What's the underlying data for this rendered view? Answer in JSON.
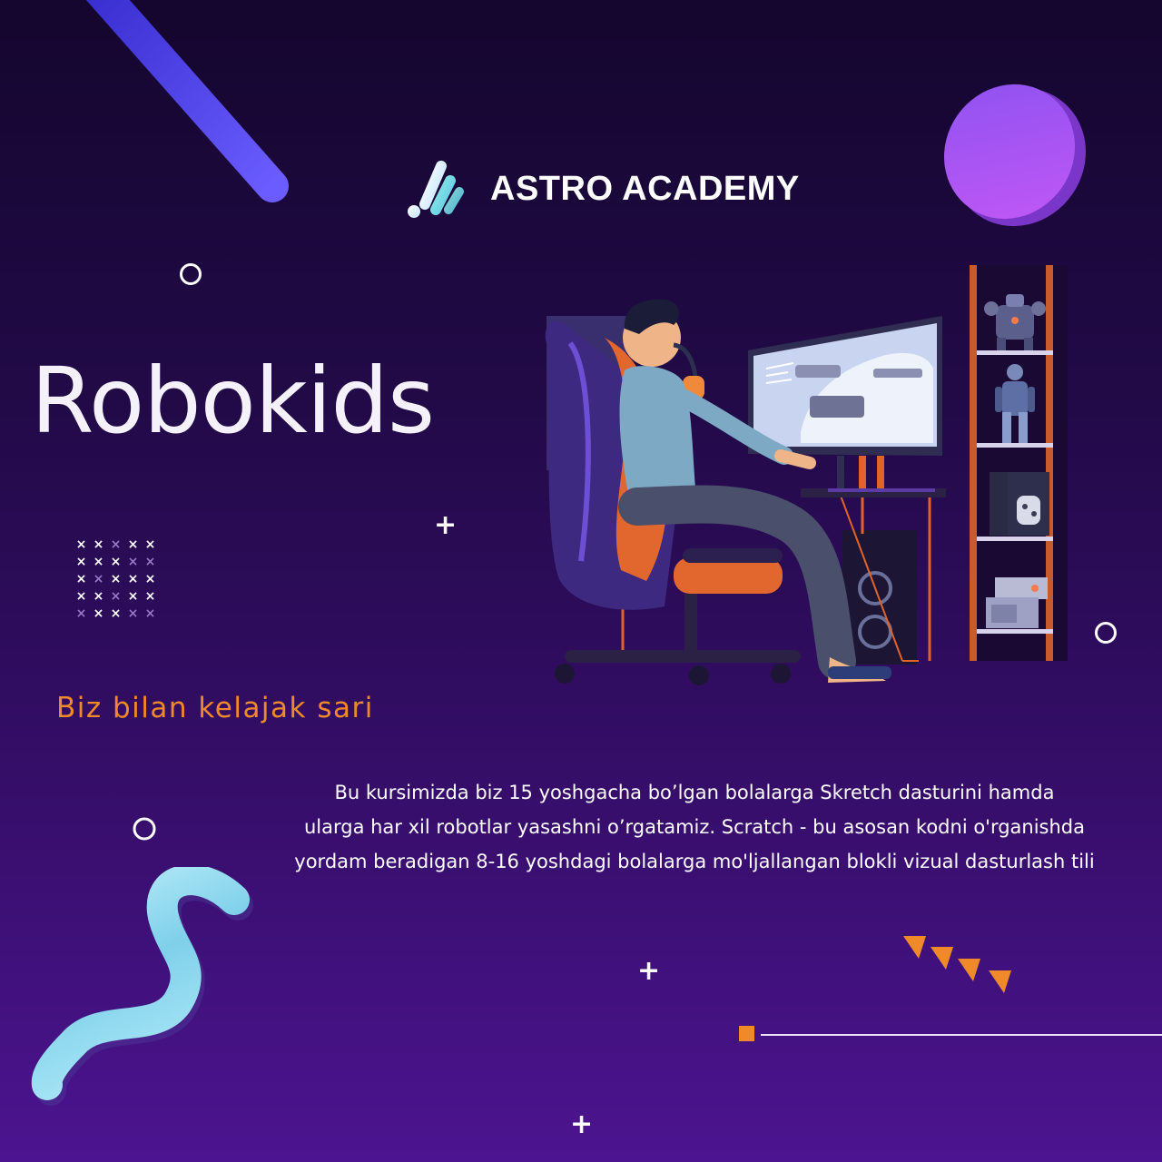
{
  "brand": {
    "name": "ASTRO ACADEMY",
    "logo_icon": "astro-academy-logo-icon",
    "logo_colors": [
      "#eaf6ff",
      "#7fe3e6",
      "#9be7d9"
    ]
  },
  "headline": "Robokids",
  "tagline": "Biz bilan kelajak sari",
  "description": {
    "lines": [
      "Bu kursimizda biz 15 yoshgacha bo’lgan bolalarga Skretch dasturini hamda",
      "ularga har xil robotlar yasashni o’rgatamiz. Scratch - bu asosan kodni o'rganishda",
      "yordam beradigan 8-16 yoshdagi bolalarga mo'ljallangan blokli vizual dasturlash tili"
    ]
  },
  "illustration": "gamer-at-desk-illustration",
  "colors": {
    "background_top": "#14062e",
    "background_bottom": "#4c1490",
    "headline": "#f4f1fb",
    "tagline": "#f0892a",
    "accent_orange": "#f0892a",
    "accent_purple": "#a855f7",
    "accent_cyan": "#7dd3e8"
  }
}
